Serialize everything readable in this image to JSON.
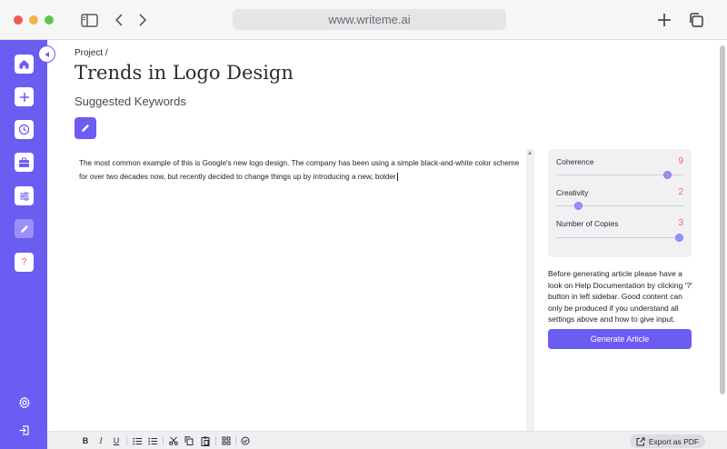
{
  "browser": {
    "url": "www.writeme.ai"
  },
  "colors": {
    "accent": "#6b5cf2",
    "accent_light": "#9b90f7",
    "value": "#ee6b5a"
  },
  "sidebar": {
    "items": [
      {
        "name": "home",
        "icon": "home-icon"
      },
      {
        "name": "new",
        "icon": "plus-icon"
      },
      {
        "name": "history",
        "icon": "clock-icon"
      },
      {
        "name": "projects",
        "icon": "briefcase-icon"
      },
      {
        "name": "settings-sliders",
        "icon": "sliders-icon"
      },
      {
        "name": "editor",
        "icon": "pencil-icon",
        "active": true
      },
      {
        "name": "help",
        "icon": "question-icon",
        "label": "?"
      }
    ]
  },
  "main": {
    "breadcrumb": "Project /",
    "title": "Trends in Logo Design",
    "keywords_label": "Suggested Keywords",
    "editor_text": "The most common example of this is Google's new logo design. The company has been using a simple black-and-white color scheme for over two decades now, but recently decided to change things up by introducing a new, bolder"
  },
  "settings": [
    {
      "label": "Coherence",
      "value": "9",
      "level": 0.9
    },
    {
      "label": "Creativity",
      "value": "2",
      "level": 0.15
    },
    {
      "label": "Number of Copies",
      "value": "3",
      "level": 1.0
    }
  ],
  "help_text": "Before generating article please have a look on Help Documentation by clicking '?' button in left sidebar. Good content can only be produced if you understand all settings above and how to give input.",
  "generate_label": "Generate Article",
  "toolbar": {
    "bold": "B",
    "italic": "I",
    "underline": "U",
    "export_label": "Export as PDF"
  }
}
